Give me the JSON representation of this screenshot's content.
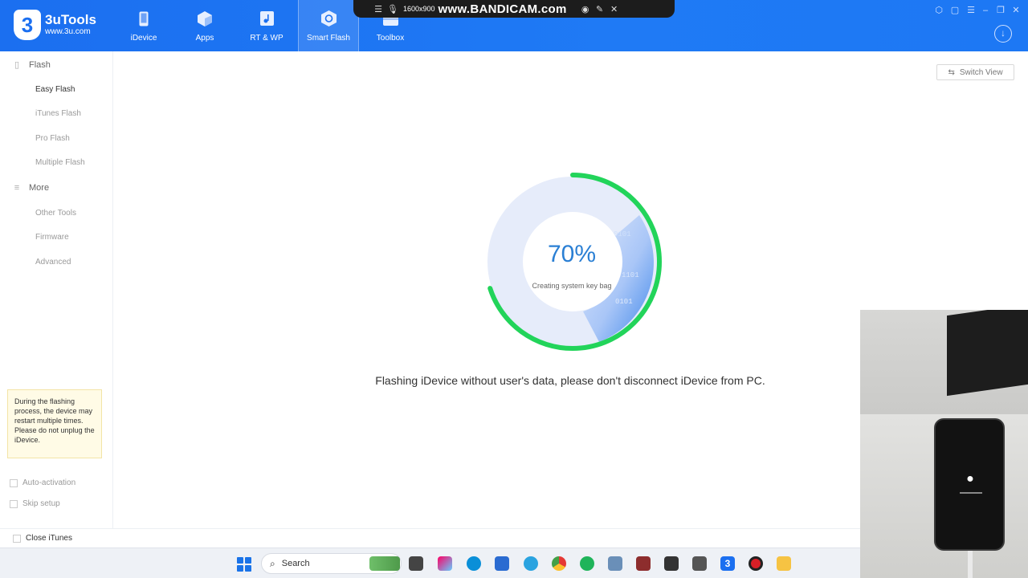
{
  "app": {
    "name": "3uTools",
    "url": "www.3u.com",
    "logo_digit": "3"
  },
  "nav": [
    {
      "label": "iDevice",
      "icon": "phone-icon"
    },
    {
      "label": "Apps",
      "icon": "cube-icon"
    },
    {
      "label": "RT & WP",
      "icon": "music-icon"
    },
    {
      "label": "Smart Flash",
      "icon": "flash-icon",
      "active": true
    },
    {
      "label": "Toolbox",
      "icon": "toolbox-icon"
    }
  ],
  "bandicam": {
    "resolution": "1600x900",
    "brand": "www.BANDICAM.com"
  },
  "sidebar": {
    "flash_section": "Flash",
    "flash_items": [
      "Easy Flash",
      "iTunes Flash",
      "Pro Flash",
      "Multiple Flash"
    ],
    "more_section": "More",
    "more_items": [
      "Other Tools",
      "Firmware",
      "Advanced"
    ],
    "note": "During the flashing process, the device may restart multiple times. Please do not unplug the iDevice.",
    "auto_activation": "Auto-activation",
    "skip_setup": "Skip setup"
  },
  "main": {
    "switch_view": "Switch View",
    "progress_percent": 70,
    "progress_label": "70%",
    "stage": "Creating system key bag",
    "message": "Flashing iDevice without user's data, please don't disconnect iDevice from PC."
  },
  "footer": {
    "close_itunes": "Close iTunes"
  },
  "taskbar": {
    "search_placeholder": "Search"
  },
  "colors": {
    "header": "#1b6ff0",
    "progress_ring": "#22d45a",
    "inner_ring": "#e4ebfa",
    "percent_text": "#2a7fd4"
  }
}
